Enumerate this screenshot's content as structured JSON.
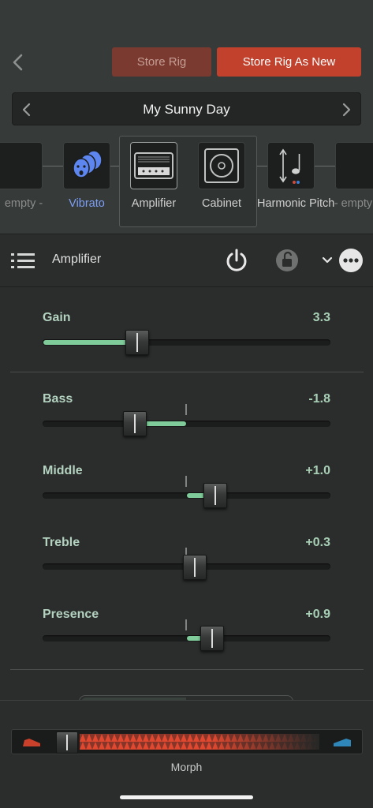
{
  "header": {
    "back_icon": "chevron-left-icon",
    "store_rig_label": "Store Rig",
    "store_rig_new_label": "Store Rig As New"
  },
  "rig": {
    "name": "My Sunny Day",
    "prev_icon": "chevron-left-icon",
    "next_icon": "chevron-right-icon"
  },
  "chain": {
    "slots": [
      {
        "label": "empty -",
        "icon": "empty-slot-icon"
      },
      {
        "label": "Vibrato",
        "icon": "vibrato-faces-icon",
        "color": "#7d9ff5"
      },
      {
        "label": "Amplifier",
        "icon": "amplifier-icon"
      },
      {
        "label": "Cabinet",
        "icon": "cabinet-speaker-icon"
      },
      {
        "label": "Harmonic Pitch",
        "icon": "harmonic-pitch-icon"
      },
      {
        "label": "- empty",
        "icon": "empty-slot-icon"
      }
    ]
  },
  "section": {
    "title": "Amplifier",
    "list_icon": "list-icon",
    "power_icon": "power-icon",
    "lock_icon": "lock-icon",
    "chevron_icon": "chevron-down-icon",
    "more_icon": "more-icon"
  },
  "params": [
    {
      "name": "Gain",
      "value": "3.3",
      "level": 0.33,
      "bipolar": false
    },
    {
      "name": "Bass",
      "value": "-1.8",
      "level": -0.18,
      "bipolar": true
    },
    {
      "name": "Middle",
      "value": "+1.0",
      "level": 0.1,
      "bipolar": true
    },
    {
      "name": "Treble",
      "value": "+0.3",
      "level": 0.03,
      "bipolar": true
    },
    {
      "name": "Presence",
      "value": "+0.9",
      "level": 0.09,
      "bipolar": true
    }
  ],
  "morph": {
    "label": "Morph",
    "level": 0.0,
    "left_pedal_icon": "pedal-icon",
    "right_pedal_icon": "pedal-icon",
    "colors": {
      "left": "#c9402b",
      "right": "#2f86b8",
      "fill": "#e0482f"
    }
  },
  "colors": {
    "accent_green": "#7fcb9a",
    "store_new": "#c1412c",
    "store_disabled": "#7a3a30"
  }
}
